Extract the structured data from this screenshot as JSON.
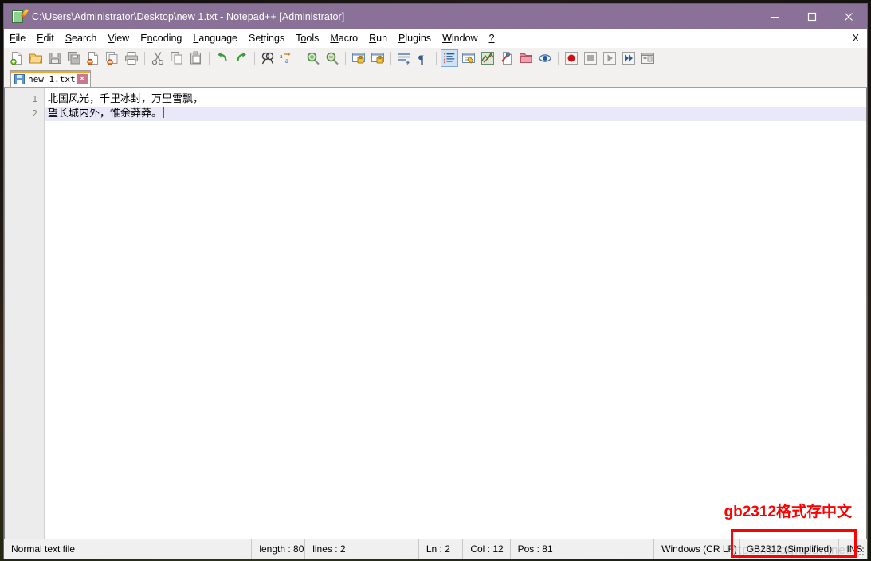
{
  "window": {
    "title": "C:\\Users\\Administrator\\Desktop\\new 1.txt - Notepad++ [Administrator]",
    "app_icon": "notepad-pencil-icon",
    "controls": {
      "minimize": "—",
      "maximize": "□",
      "close": "✕"
    },
    "titlebar_color": "#8a7197"
  },
  "menubar": {
    "items": [
      {
        "label": "File",
        "accel": "F"
      },
      {
        "label": "Edit",
        "accel": "E"
      },
      {
        "label": "Search",
        "accel": "S"
      },
      {
        "label": "View",
        "accel": "V"
      },
      {
        "label": "Encoding",
        "accel": "n"
      },
      {
        "label": "Language",
        "accel": "L"
      },
      {
        "label": "Settings",
        "accel": "t"
      },
      {
        "label": "Tools",
        "accel": "o"
      },
      {
        "label": "Macro",
        "accel": "M"
      },
      {
        "label": "Run",
        "accel": "R"
      },
      {
        "label": "Plugins",
        "accel": "P"
      },
      {
        "label": "Window",
        "accel": "W"
      },
      {
        "label": "?",
        "accel": "?"
      }
    ],
    "close_document_x": "X"
  },
  "toolbar": {
    "buttons": [
      {
        "name": "new-file-icon",
        "group": 1
      },
      {
        "name": "open-file-icon",
        "group": 1
      },
      {
        "name": "save-icon",
        "group": 1
      },
      {
        "name": "save-all-icon",
        "group": 1
      },
      {
        "name": "close-file-icon",
        "group": 1
      },
      {
        "name": "close-all-files-icon",
        "group": 1
      },
      {
        "name": "print-icon",
        "group": 1
      },
      {
        "name": "cut-icon",
        "group": 2
      },
      {
        "name": "copy-icon",
        "group": 2
      },
      {
        "name": "paste-icon",
        "group": 2
      },
      {
        "name": "undo-icon",
        "group": 3
      },
      {
        "name": "redo-icon",
        "group": 3
      },
      {
        "name": "find-icon",
        "group": 4
      },
      {
        "name": "replace-icon",
        "group": 4
      },
      {
        "name": "zoom-in-icon",
        "group": 5
      },
      {
        "name": "zoom-out-icon",
        "group": 5
      },
      {
        "name": "sync-vertical-scrolling-icon",
        "group": 6
      },
      {
        "name": "sync-horizontal-scrolling-icon",
        "group": 6
      },
      {
        "name": "word-wrap-icon",
        "group": 7
      },
      {
        "name": "show-all-characters-icon",
        "group": 7
      },
      {
        "name": "indent-guideline-icon",
        "group": 8,
        "active": true
      },
      {
        "name": "user-defined-dialog-icon",
        "group": 8
      },
      {
        "name": "document-map-icon",
        "group": 8
      },
      {
        "name": "function-list-icon",
        "group": 8
      },
      {
        "name": "folder-as-workspace-icon",
        "group": 8
      },
      {
        "name": "monitoring-icon",
        "group": 8
      },
      {
        "name": "macro-record-icon",
        "group": 9
      },
      {
        "name": "macro-stop-icon",
        "group": 9
      },
      {
        "name": "macro-playback-icon",
        "group": 9
      },
      {
        "name": "macro-run-multiple-icon",
        "group": 9
      },
      {
        "name": "macro-save-icon",
        "group": 9
      }
    ]
  },
  "tabs": [
    {
      "label": "new 1.txt",
      "saved_icon": "floppy-disk-icon",
      "close_icon": "close-tab-icon",
      "active": true,
      "accent_color": "#f5a623"
    }
  ],
  "editor": {
    "line_numbers": [
      "1",
      "2"
    ],
    "lines": [
      "北国风光，千里冰封，万里雪飘，",
      "望长城内外，惟余莽莽。"
    ],
    "current_line_index": 1,
    "caret_color": "#7a3fb0",
    "current_line_highlight": "#e8e8f8"
  },
  "annotation": {
    "text": "gb2312格式存中文",
    "color": "#ff0000"
  },
  "statusbar": {
    "doc_type": "Normal text file",
    "length": "length : 80",
    "lines": "lines : 2",
    "ln": "Ln : 2",
    "col": "Col : 12",
    "pos": "Pos : 81",
    "eol": "Windows (CR LF)",
    "encoding": "GB2312 (Simplified)",
    "insert_mode": "INS",
    "highlight_color": "#ff0000",
    "watermark": "https://blog.csdn.net/"
  }
}
